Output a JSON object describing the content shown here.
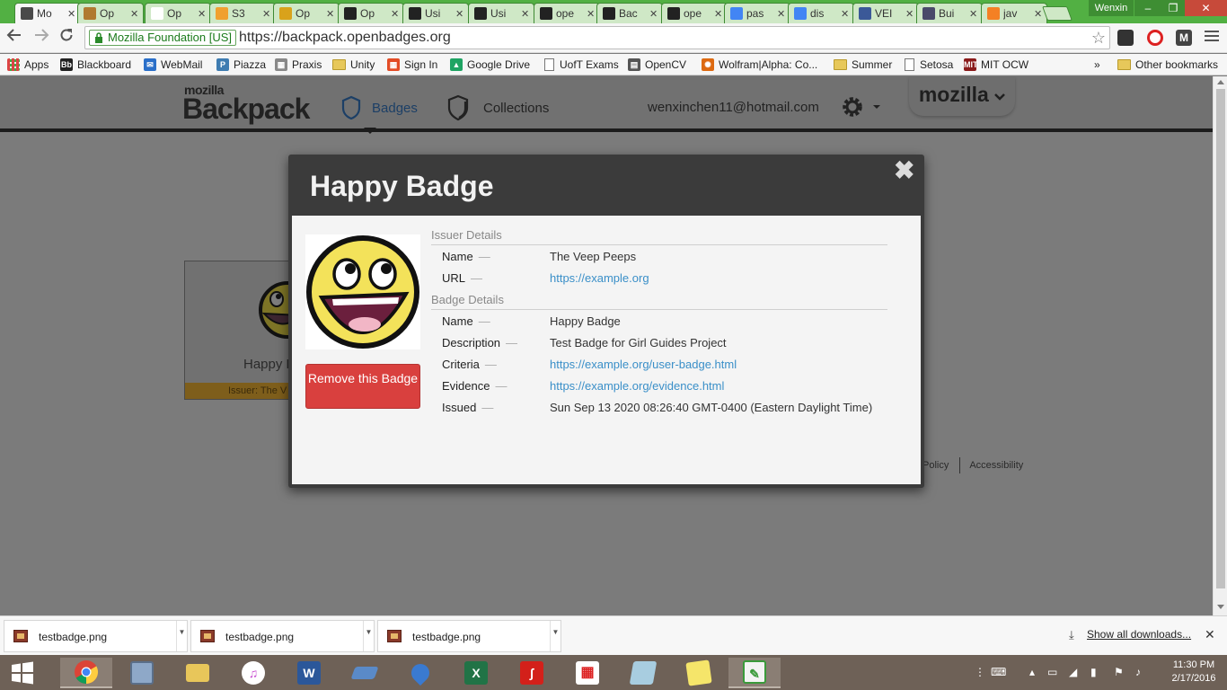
{
  "browser": {
    "tabs": [
      {
        "title": "Mo",
        "favicon_color": "#4a4a4a",
        "active": true
      },
      {
        "title": "Op",
        "favicon_color": "#b07a30"
      },
      {
        "title": "Op",
        "favicon_color": "#ffffff"
      },
      {
        "title": "S3",
        "favicon_color": "#f0a030"
      },
      {
        "title": "Op",
        "favicon_color": "#d9a21b"
      },
      {
        "title": "Op",
        "favicon_color": "#222222"
      },
      {
        "title": "Usi",
        "favicon_color": "#222222"
      },
      {
        "title": "Usi",
        "favicon_color": "#222222"
      },
      {
        "title": "ope",
        "favicon_color": "#222222"
      },
      {
        "title": "Bac",
        "favicon_color": "#222222"
      },
      {
        "title": "ope",
        "favicon_color": "#222222"
      },
      {
        "title": "pas",
        "favicon_color": "#4285f4"
      },
      {
        "title": "dis",
        "favicon_color": "#4285f4"
      },
      {
        "title": "VEI",
        "favicon_color": "#3b5998"
      },
      {
        "title": "Bui",
        "favicon_color": "#4a4a6a"
      },
      {
        "title": "jav",
        "favicon_color": "#f48024"
      }
    ],
    "window_user": "Wenxin",
    "window_controls": {
      "minimize": "–",
      "restore": "❐",
      "close": "✕"
    },
    "security_label": "Mozilla Foundation [US]",
    "url": "https://backpack.openbadges.org",
    "bookmarks": [
      {
        "label": "Apps",
        "type": "apps"
      },
      {
        "label": "Blackboard",
        "type": "icon",
        "icon_text": "Bb",
        "color": "#222222"
      },
      {
        "label": "WebMail",
        "type": "icon",
        "icon_text": "✉",
        "color": "#2a6fc9"
      },
      {
        "label": "Piazza",
        "type": "icon",
        "icon_text": "P",
        "color": "#3e7cb1"
      },
      {
        "label": "Praxis",
        "type": "icon",
        "icon_text": "▦",
        "color": "#888888"
      },
      {
        "label": "Unity",
        "type": "folder"
      },
      {
        "label": "Sign In",
        "type": "icon",
        "icon_text": "▦",
        "color": "#e34c26"
      },
      {
        "label": "Google Drive",
        "type": "icon",
        "icon_text": "▲",
        "color": "#1fa463"
      },
      {
        "label": "UofT Exams",
        "type": "page"
      },
      {
        "label": "OpenCV",
        "type": "icon",
        "icon_text": "▤",
        "color": "#555555"
      },
      {
        "label": "Wolfram|Alpha: Co...",
        "type": "icon",
        "icon_text": "✺",
        "color": "#dd6a11"
      },
      {
        "label": "Summer",
        "type": "folder"
      },
      {
        "label": "Setosa",
        "type": "page"
      },
      {
        "label": "MIT OCW",
        "type": "icon",
        "icon_text": "MIT",
        "color": "#8a1a1a"
      }
    ],
    "bookmarks_overflow": "»",
    "other_bookmarks": "Other bookmarks"
  },
  "site": {
    "logo_small": "mozilla",
    "logo_main": "Backpack",
    "nav": {
      "badges": "Badges",
      "collections": "Collections"
    },
    "user_email": "wenxinchen11@hotmail.com",
    "mozilla_tab": "mozilla",
    "background_card": {
      "name": "Happy B",
      "issuer": "Issuer: The V"
    },
    "footer": {
      "policy": "Policy",
      "accessibility": "Accessibility"
    }
  },
  "modal": {
    "title": "Happy Badge",
    "close_symbol": "✖",
    "remove_button": "Remove this Badge",
    "issuer_section": "Issuer Details",
    "issuer": [
      {
        "key": "Name",
        "value": "The Veep Peeps",
        "link": false
      },
      {
        "key": "URL",
        "value": "https://example.org",
        "link": true
      }
    ],
    "badge_section": "Badge Details",
    "badge": [
      {
        "key": "Name",
        "value": "Happy Badge",
        "link": false
      },
      {
        "key": "Description",
        "value": "Test Badge for Girl Guides Project",
        "link": false
      },
      {
        "key": "Criteria",
        "value": "https://example.org/user-badge.html",
        "link": true
      },
      {
        "key": "Evidence",
        "value": "https://example.org/evidence.html",
        "link": true
      },
      {
        "key": "Issued",
        "value": "Sun Sep 13 2020 08:26:40 GMT-0400 (Eastern Daylight Time)",
        "link": false
      }
    ],
    "dash": "—"
  },
  "downloads": {
    "items": [
      "testbadge.png",
      "testbadge.png",
      "testbadge.png"
    ],
    "show_all": "Show all downloads...",
    "close_symbol": "✕"
  },
  "taskbar": {
    "time": "11:30 PM",
    "date": "2/17/2016",
    "apps": [
      {
        "name": "chrome",
        "active": true
      },
      {
        "name": "calculator"
      },
      {
        "name": "file-explorer"
      },
      {
        "name": "itunes"
      },
      {
        "name": "word",
        "label": "W"
      },
      {
        "name": "eraser"
      },
      {
        "name": "droplet"
      },
      {
        "name": "excel",
        "label": "X"
      },
      {
        "name": "acrobat"
      },
      {
        "name": "app-grid"
      },
      {
        "name": "notepad-tool"
      },
      {
        "name": "sticky-notes"
      },
      {
        "name": "editor",
        "active": true
      }
    ]
  }
}
